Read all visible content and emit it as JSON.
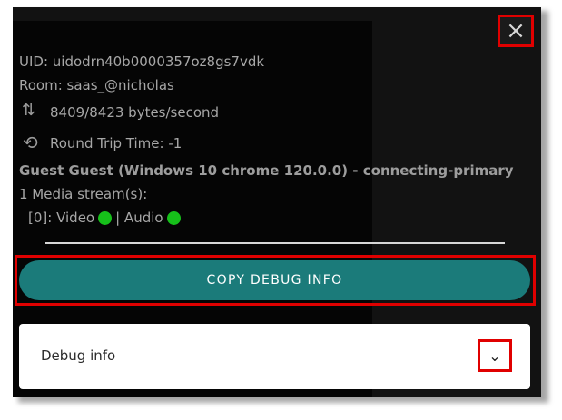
{
  "dialog": {
    "close_icon": "close-icon",
    "uid": "UID: uidodrn40b0000357oz8gs7vdk",
    "room": "Room: saas_@nicholas",
    "bytes_per_second": "8409/8423 bytes/second",
    "round_trip_time": "Round Trip Time: -1",
    "guest": "Guest Guest (Windows 10 chrome 120.0.0) - connecting-primary",
    "media_streams": "1 Media stream(s):",
    "stream": {
      "index_video": "[0]: Video",
      "audio": "| Audio",
      "video_status_color": "#16c01a",
      "audio_status_color": "#16c01a"
    },
    "copy_button": "COPY DEBUG INFO",
    "debug_info_label": "Debug info",
    "icons": {
      "bytes": "arrows-up-down-icon",
      "rtt": "sync-icon",
      "expand": "chevron-down-icon"
    },
    "colors": {
      "accent": "#1b7b7a",
      "highlight": "#e00000"
    }
  }
}
